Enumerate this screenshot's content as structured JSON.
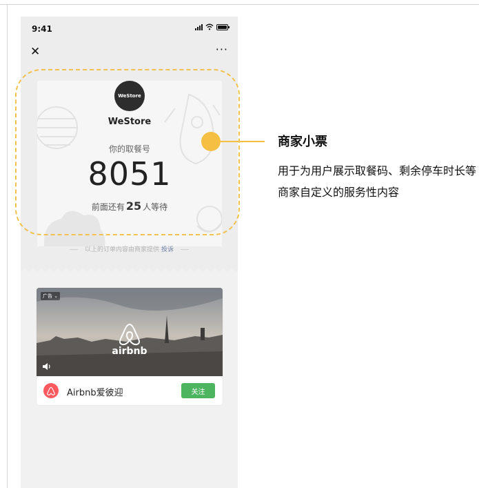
{
  "status_bar": {
    "time": "9:41"
  },
  "ticket": {
    "store_logo_text": "WeStore",
    "store_name": "WeStore",
    "pickup_label": "你的取餐号",
    "pickup_number": "8051",
    "queue_prefix": "前面还有",
    "queue_count": "25",
    "queue_suffix": "人等待"
  },
  "merchant_note": {
    "text": "以上的订单内容由商家提供",
    "report_link": "投诉"
  },
  "ad": {
    "badge": "广告",
    "brand": "airbnb",
    "account_name": "Airbnb爱彼迎",
    "follow_label": "关注"
  },
  "callout": {
    "title": "商家小票",
    "description": "用于为用户展示取餐码、剩余停车时长等商家自定义的服务性内容"
  },
  "colors": {
    "accent_yellow": "#f4bf42",
    "follow_green": "#4db560",
    "airbnb_red": "#ff5a5f"
  }
}
